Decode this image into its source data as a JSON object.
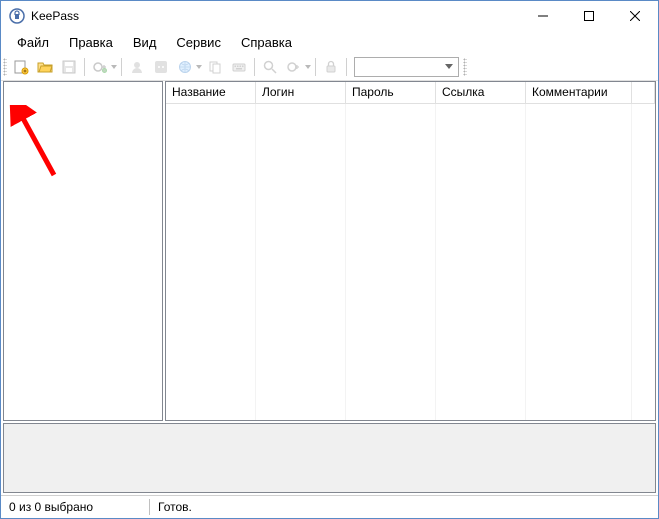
{
  "app": {
    "title": "KeePass"
  },
  "menu": {
    "file": "Файл",
    "edit": "Правка",
    "view": "Вид",
    "tools": "Сервис",
    "help": "Справка"
  },
  "columns": {
    "title": "Название",
    "user": "Логин",
    "pass": "Пароль",
    "url": "Ссылка",
    "notes": "Комментарии"
  },
  "status": {
    "selection": "0 из 0 выбрано",
    "ready": "Готов."
  },
  "quick_search": {
    "placeholder": ""
  },
  "colors": {
    "accent": "#5a8ac6",
    "arrow": "#ff0000"
  }
}
